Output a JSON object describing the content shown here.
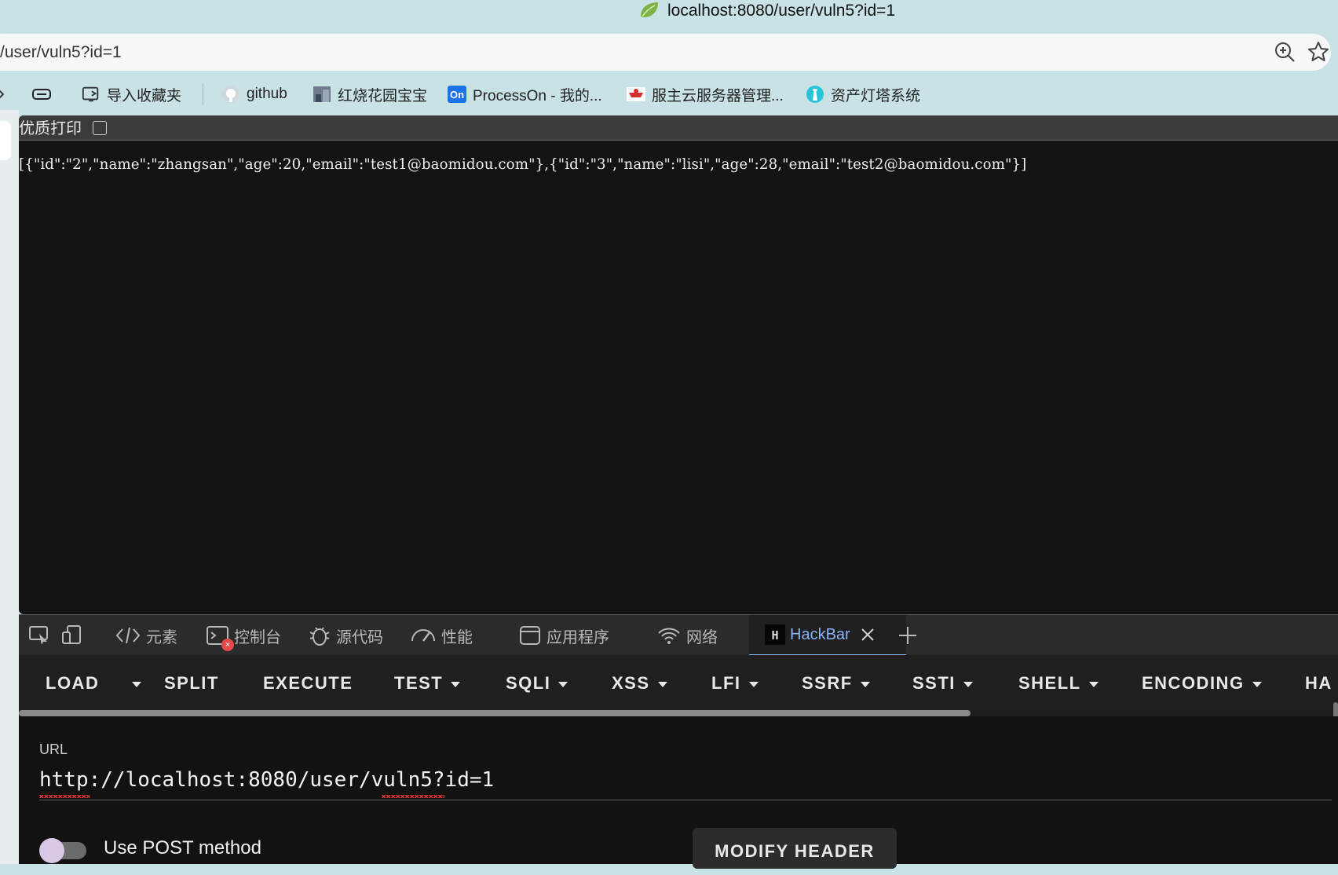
{
  "window": {
    "title": "localhost:8080/user/vuln5?id=1"
  },
  "address_bar": {
    "url": "/user/vuln5?id=1"
  },
  "bookmarks": [
    {
      "label": "导入收藏夹",
      "icon": "import-icon"
    },
    {
      "label": "github",
      "icon": "github-icon"
    },
    {
      "label": "红烧花园宝宝",
      "icon": "image-icon"
    },
    {
      "label": "ProcessOn - 我的...",
      "icon": "processon-icon"
    },
    {
      "label": "服主云服务器管理...",
      "icon": "cloud-icon"
    },
    {
      "label": "资产灯塔系统",
      "icon": "lighthouse-icon"
    }
  ],
  "page": {
    "pretty_print_label": "优质打印",
    "pretty_print_checked": false,
    "json_text": "[{\"id\":\"2\",\"name\":\"zhangsan\",\"age\":20,\"email\":\"test1@baomidou.com\"},{\"id\":\"3\",\"name\":\"lisi\",\"age\":28,\"email\":\"test2@baomidou.com\"}]"
  },
  "devtools": {
    "tabs": [
      {
        "label": "元素",
        "icon": "code-icon"
      },
      {
        "label": "控制台",
        "icon": "console-icon"
      },
      {
        "label": "源代码",
        "icon": "bug-icon"
      },
      {
        "label": "性能",
        "icon": "gauge-icon"
      },
      {
        "label": "应用程序",
        "icon": "window-icon"
      },
      {
        "label": "网络",
        "icon": "wifi-icon"
      },
      {
        "label": "HackBar",
        "icon": "hackbar-icon",
        "active": true
      }
    ],
    "console_error_count": "×"
  },
  "hackbar": {
    "toolbar": {
      "load": "LOAD",
      "split": "SPLIT",
      "execute": "EXECUTE",
      "test": "TEST",
      "sqli": "SQLI",
      "xss": "XSS",
      "lfi": "LFI",
      "ssrf": "SSRF",
      "ssti": "SSTI",
      "shell": "SHELL",
      "encoding": "ENCODING",
      "ha": "HA"
    },
    "url_label": "URL",
    "url_value": "http://localhost:8080/user/vuln5?id=1",
    "post_label": "Use POST method",
    "post_enabled": false,
    "modify_header": "MODIFY HEADER"
  },
  "colors": {
    "accent": "#8ab4f8",
    "page_bg": "#131313",
    "chrome_bg": "#c9e2e6"
  }
}
